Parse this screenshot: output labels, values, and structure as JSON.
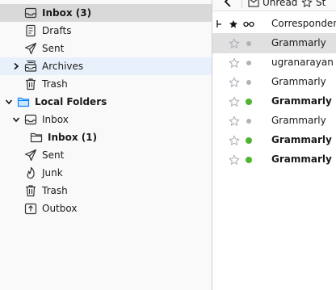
{
  "folders": [
    {
      "label": "Inbox (3)",
      "bold": true,
      "icon": "inbox-icon",
      "indent": 1,
      "twisty": "",
      "selected": true
    },
    {
      "label": "Drafts",
      "bold": false,
      "icon": "drafts-icon",
      "indent": 1,
      "twisty": ""
    },
    {
      "label": "Sent",
      "bold": false,
      "icon": "sent-icon",
      "indent": 1,
      "twisty": ""
    },
    {
      "label": "Archives",
      "bold": false,
      "icon": "archive-icon",
      "indent": 1,
      "twisty": "collapsed",
      "hovered": true
    },
    {
      "label": "Trash",
      "bold": false,
      "icon": "trash-icon",
      "indent": 1,
      "twisty": ""
    },
    {
      "label": "Local Folders",
      "bold": true,
      "icon": "local-folders-icon",
      "indent": 0,
      "twisty": "expanded"
    },
    {
      "label": "Inbox",
      "bold": false,
      "icon": "inbox-icon",
      "indent": 1,
      "twisty": "expanded"
    },
    {
      "label": "Inbox (1)",
      "bold": true,
      "icon": "folder-icon",
      "indent": 2,
      "twisty": ""
    },
    {
      "label": "Sent",
      "bold": false,
      "icon": "sent-icon",
      "indent": 1,
      "twisty": ""
    },
    {
      "label": "Junk",
      "bold": false,
      "icon": "junk-icon",
      "indent": 1,
      "twisty": ""
    },
    {
      "label": "Trash",
      "bold": false,
      "icon": "trash-icon",
      "indent": 1,
      "twisty": ""
    },
    {
      "label": "Outbox",
      "bold": false,
      "icon": "outbox-icon",
      "indent": 1,
      "twisty": ""
    }
  ],
  "toolbar": {
    "unread_label": "Unread",
    "starred_label": "St"
  },
  "columns": {
    "correspondent_label": "Correspondent"
  },
  "messages": [
    {
      "sender": "Grammarly",
      "unread": false,
      "selected": true
    },
    {
      "sender": "ugranarayan",
      "unread": false
    },
    {
      "sender": "Grammarly",
      "unread": false
    },
    {
      "sender": "Grammarly",
      "unread": true
    },
    {
      "sender": "Grammarly",
      "unread": false
    },
    {
      "sender": "Grammarly",
      "unread": true
    },
    {
      "sender": "Grammarly",
      "unread": true
    }
  ],
  "colors": {
    "unread_dot": "#4eb530",
    "read_dot": "#b1b1b9",
    "selected_row": "#d9d9d9",
    "hover_row": "#e8f1fb",
    "folder_blue": "#0a84ff"
  }
}
